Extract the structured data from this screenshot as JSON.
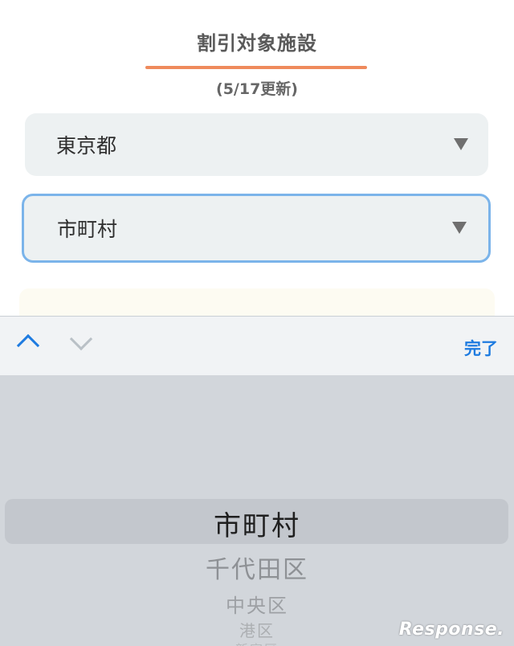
{
  "header": {
    "title": "割引対象施設",
    "updated": "(5/17更新)"
  },
  "form": {
    "prefecture_value": "東京都",
    "city_value": "市町村"
  },
  "keyboard_toolbar": {
    "done_label": "完了"
  },
  "picker": {
    "selected": "市町村",
    "options": [
      "千代田区",
      "中央区",
      "港区",
      "新宿区"
    ]
  },
  "watermark": "Response.",
  "colors": {
    "accent_orange": "#ef8a5c",
    "accent_blue": "#1e7be0",
    "focus_border": "#7bb4ea"
  }
}
